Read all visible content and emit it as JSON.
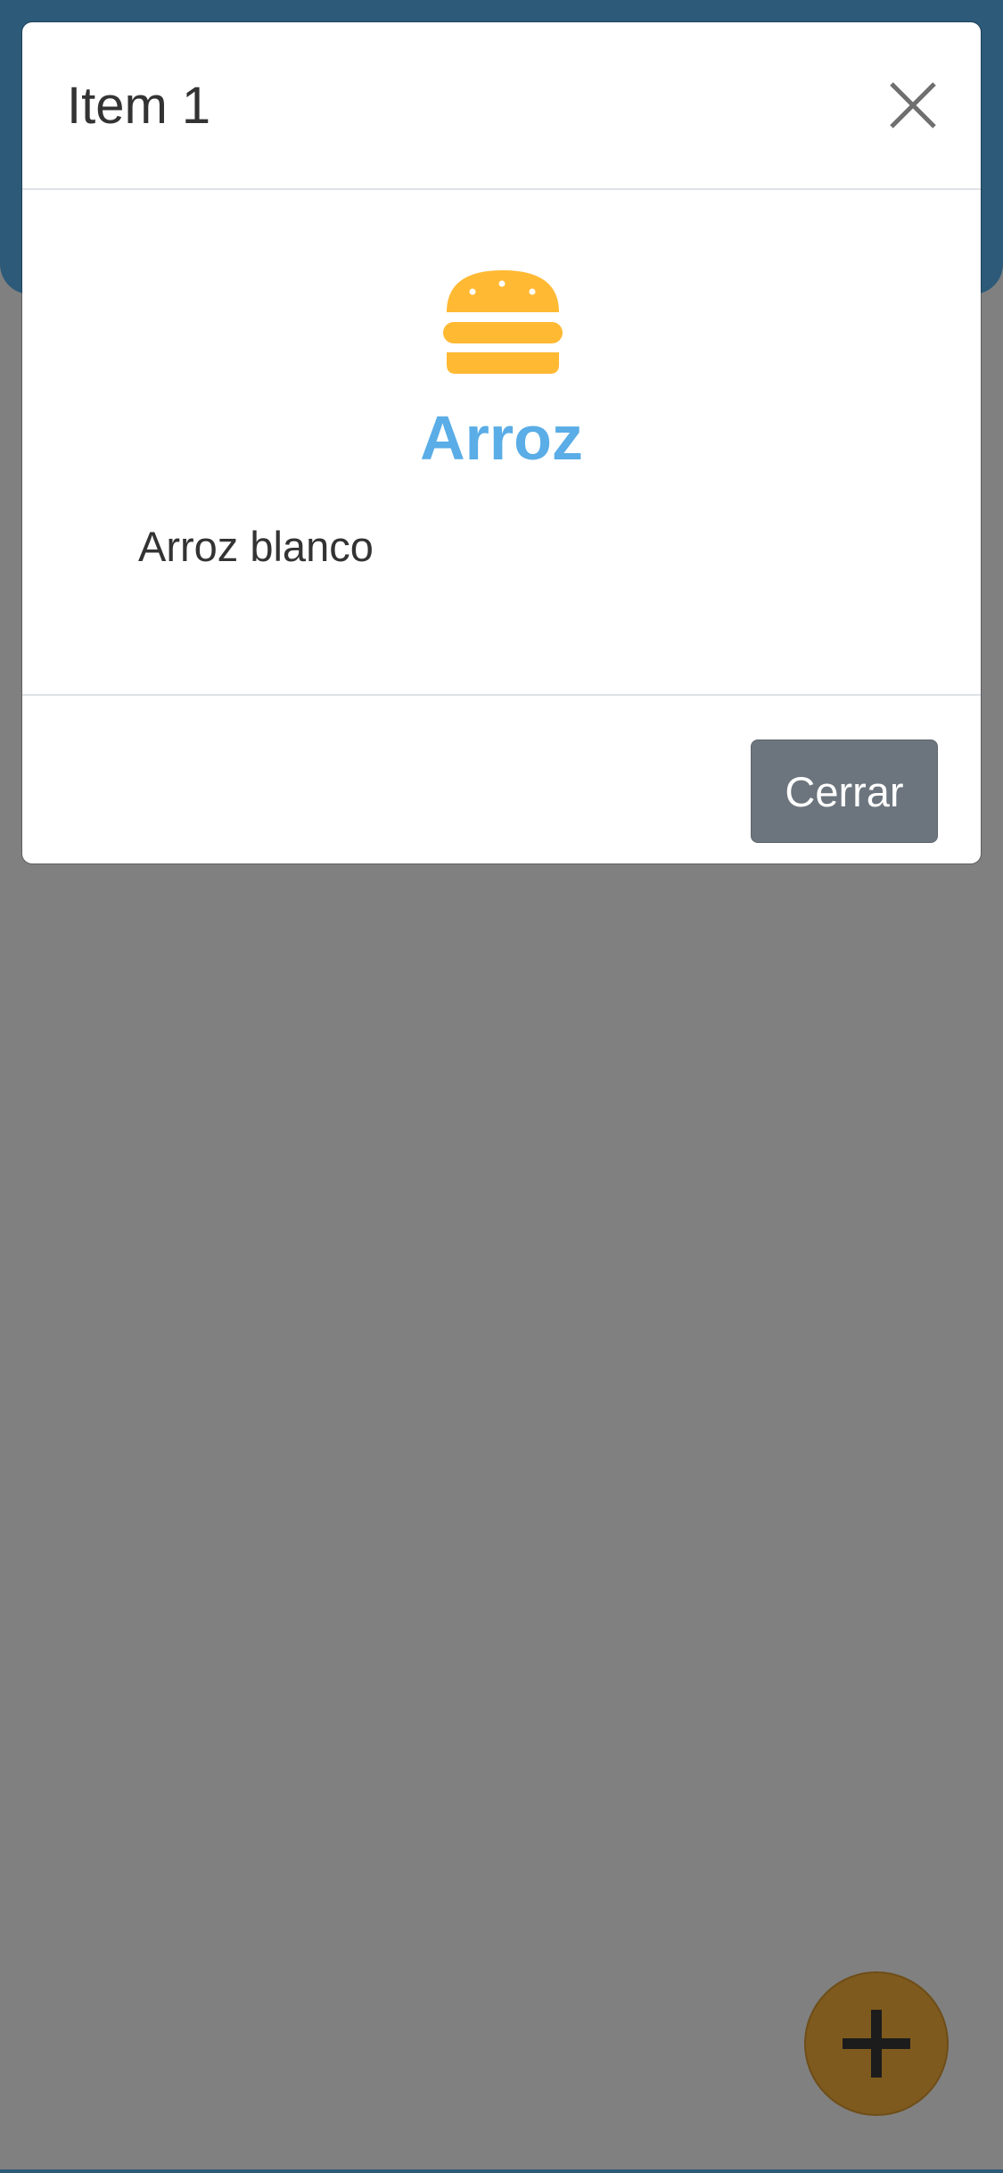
{
  "modal": {
    "title": "Item 1",
    "close_icon": "close-icon",
    "item": {
      "icon": "hamburger-icon",
      "icon_color": "#ffb933",
      "name": "Arroz",
      "name_color": "#5aade6",
      "description": "Arroz blanco"
    },
    "footer": {
      "close_label": "Cerrar"
    }
  },
  "fab": {
    "icon": "plus-icon"
  },
  "colors": {
    "header": "#2c5a78",
    "overlay": "#808080",
    "fab": "#7e5a1e",
    "secondary_button": "#6c757d"
  }
}
